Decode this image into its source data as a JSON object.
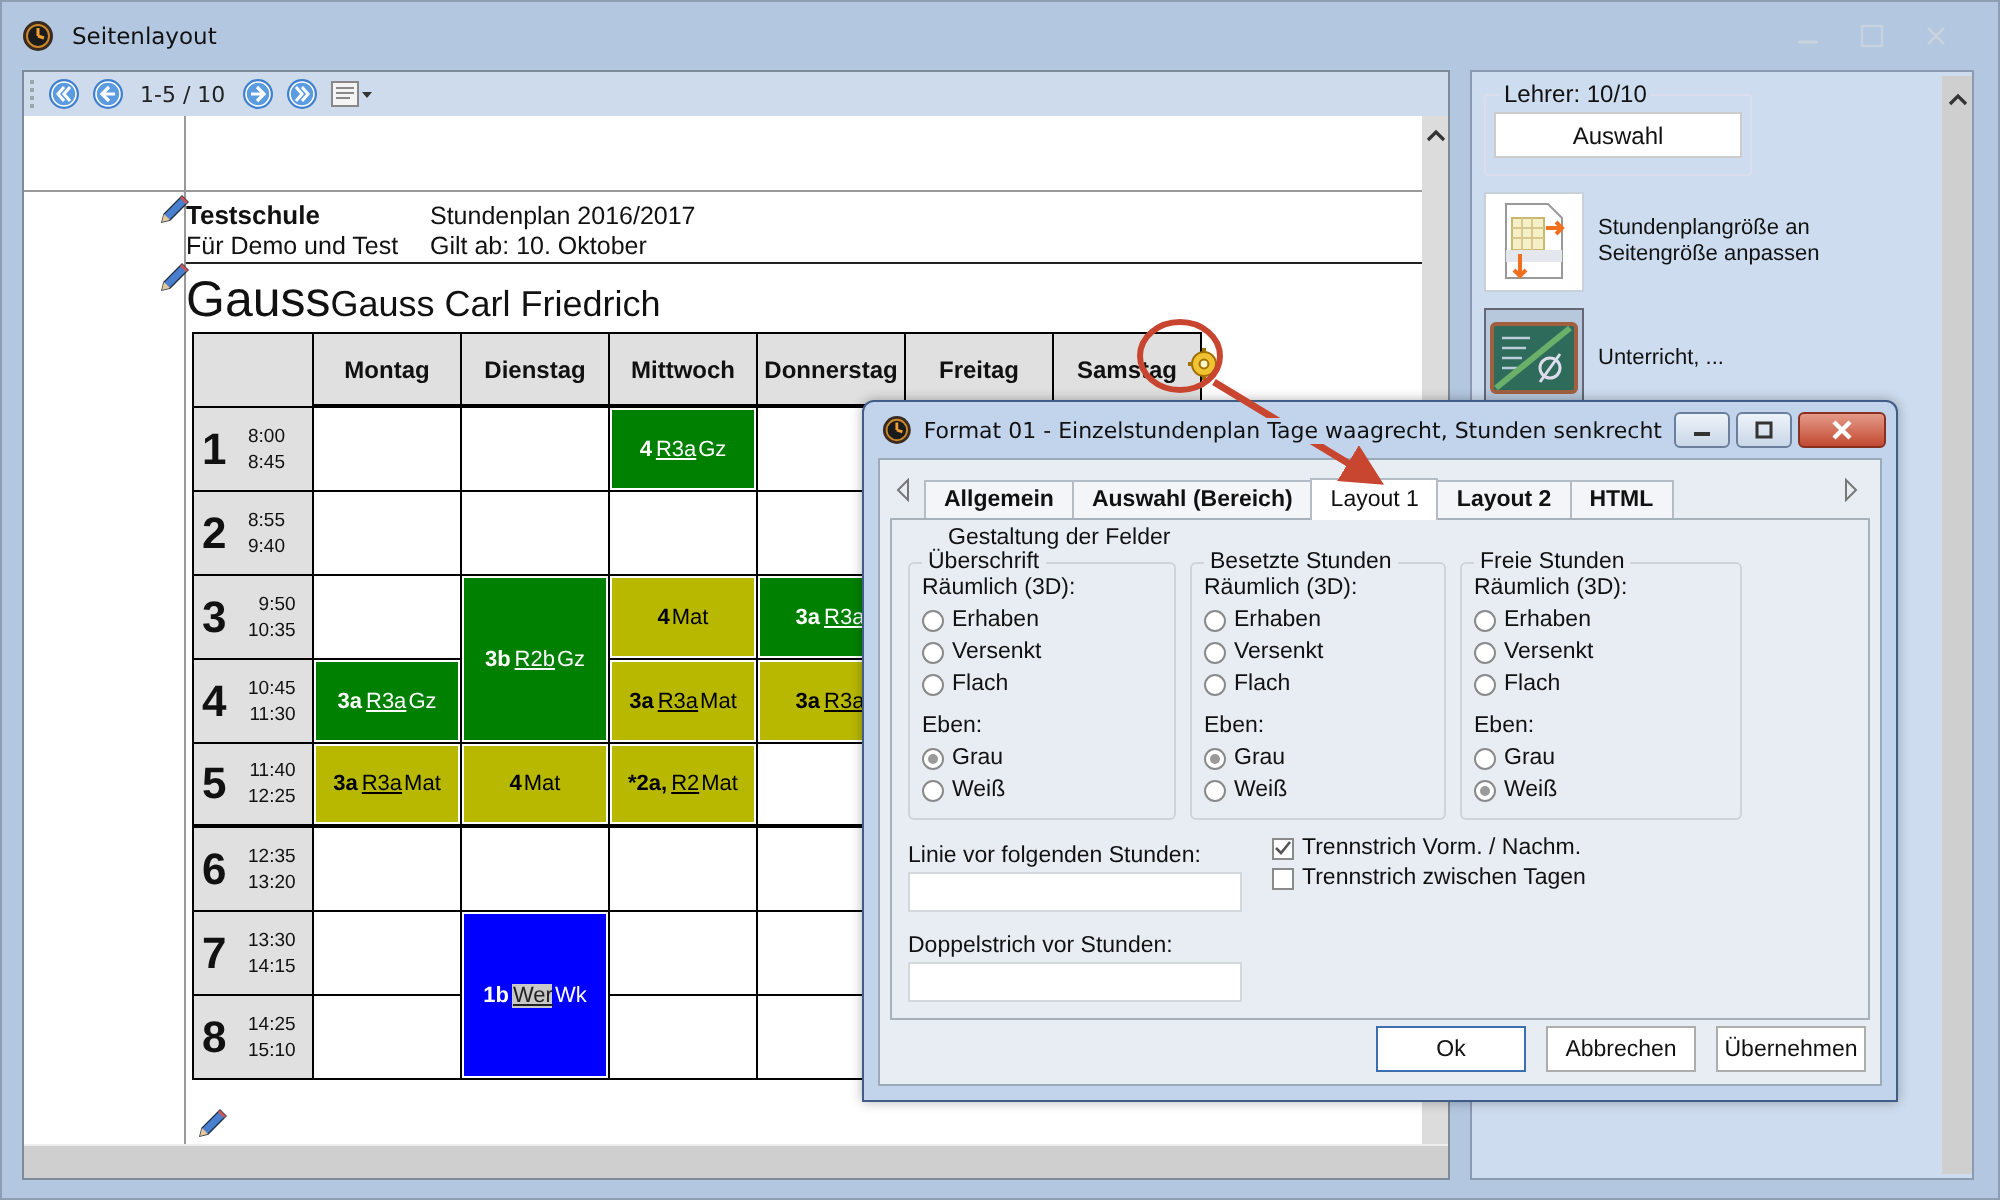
{
  "window": {
    "title": "Seitenlayout"
  },
  "toolbar": {
    "page_range": "1-5 / 10"
  },
  "page": {
    "school": "Testschule",
    "subtitle": "Für Demo und Test",
    "plan": "Stundenplan 2016/2017",
    "valid_from": "Gilt ab: 10. Oktober",
    "short_name": "Gauss",
    "full_name": "Gauss Carl Friedrich",
    "timetable": {
      "days": [
        "Montag",
        "Dienstag",
        "Mittwoch",
        "Donnerstag",
        "Freitag",
        "Samstag"
      ],
      "rows": [
        {
          "number": "1",
          "start": "8:00",
          "end": "8:45",
          "cells": [
            {
              "kind": "empty"
            },
            {
              "kind": "empty"
            },
            {
              "kind": "single",
              "class": "4",
              "room": "R3a",
              "subject": "Gz",
              "color": "#008000",
              "room_highlighted": false
            },
            {
              "kind": "empty"
            },
            {
              "kind": "empty"
            },
            {
              "kind": "empty"
            }
          ]
        },
        {
          "number": "2",
          "start": "8:55",
          "end": "9:40",
          "cells": [
            {
              "kind": "empty"
            },
            {
              "kind": "empty"
            },
            {
              "kind": "empty"
            },
            {
              "kind": "empty"
            },
            {
              "kind": "empty"
            },
            {
              "kind": "empty"
            }
          ]
        },
        {
          "number": "3",
          "start": "9:50",
          "end": "10:35",
          "cells": [
            {
              "kind": "empty"
            },
            {
              "kind": "double",
              "class": "3b",
              "room": "R2b",
              "subject": "Gz",
              "color": "#008000",
              "room_highlighted": false
            },
            {
              "kind": "single",
              "class": "4",
              "subject": "Mat",
              "color": "#b8b800"
            },
            {
              "kind": "single",
              "class": "3a",
              "room": "R3a",
              "color": "#008000",
              "room_highlighted": false
            },
            {
              "kind": "empty"
            },
            {
              "kind": "empty"
            }
          ]
        },
        {
          "number": "4",
          "start": "10:45",
          "end": "11:30",
          "cells": [
            {
              "kind": "single",
              "class": "3a",
              "room": "R3a",
              "subject": "Gz",
              "color": "#008000",
              "room_highlighted": false
            },
            {
              "kind": "covered"
            },
            {
              "kind": "single",
              "class": "3a",
              "room": "R3a",
              "subject": "Mat",
              "color": "#b8b800",
              "room_highlighted": false
            },
            {
              "kind": "single",
              "class": "3a",
              "room": "R3a",
              "color": "#b8b800",
              "room_highlighted": false
            },
            {
              "kind": "empty"
            },
            {
              "kind": "empty"
            }
          ]
        },
        {
          "number": "5",
          "start": "11:40",
          "end": "12:25",
          "cells": [
            {
              "kind": "single",
              "class": "3a",
              "room": "R3a",
              "subject": "Mat",
              "color": "#b8b800",
              "room_highlighted": false
            },
            {
              "kind": "single",
              "class": "4",
              "subject": "Mat",
              "color": "#b8b800"
            },
            {
              "kind": "single",
              "class": "*2a,",
              "room": "R2",
              "subject": "Mat",
              "color": "#b8b800",
              "room_highlighted": false
            },
            {
              "kind": "empty"
            },
            {
              "kind": "empty"
            },
            {
              "kind": "empty"
            }
          ]
        },
        {
          "number": "6",
          "start": "12:35",
          "end": "13:20",
          "cells": [
            {
              "kind": "empty"
            },
            {
              "kind": "empty"
            },
            {
              "kind": "empty"
            },
            {
              "kind": "empty"
            },
            {
              "kind": "empty"
            },
            {
              "kind": "empty"
            }
          ]
        },
        {
          "number": "7",
          "start": "13:30",
          "end": "14:15",
          "cells": [
            {
              "kind": "empty"
            },
            {
              "kind": "double",
              "class": "1b",
              "room": "Wer",
              "subject": "Wk",
              "color": "#0000ff",
              "room_highlighted": true
            },
            {
              "kind": "empty"
            },
            {
              "kind": "empty"
            },
            {
              "kind": "empty"
            },
            {
              "kind": "empty"
            }
          ]
        },
        {
          "number": "8",
          "start": "14:25",
          "end": "15:10",
          "cells": [
            {
              "kind": "empty"
            },
            {
              "kind": "covered"
            },
            {
              "kind": "empty"
            },
            {
              "kind": "empty"
            },
            {
              "kind": "empty"
            },
            {
              "kind": "empty"
            }
          ]
        }
      ]
    }
  },
  "side_panel": {
    "group_label": "Lehrer: 10/10",
    "select_button": "Auswahl",
    "actions": [
      {
        "kind": "fit",
        "label": "Stundenplangröße an Seitengröße anpassen"
      },
      {
        "kind": "lessons",
        "label": "Unterricht, ..."
      }
    ]
  },
  "dialog": {
    "title": "Format 01 - Einzelstundenplan Tage waagrecht, Stunden senkrecht",
    "tabs": [
      {
        "label": "Allgemein",
        "selected": false
      },
      {
        "label": "Auswahl (Bereich)",
        "selected": false
      },
      {
        "label": "Layout 1",
        "selected": true
      },
      {
        "label": "Layout 2",
        "selected": false
      },
      {
        "label": "HTML",
        "selected": false
      }
    ],
    "section_label": "Gestaltung der Felder",
    "groups": [
      {
        "title": "Überschrift",
        "relief_label": "Räumlich (3D):",
        "relief_options": [
          {
            "label": "Erhaben",
            "selected": false
          },
          {
            "label": "Versenkt",
            "selected": false
          },
          {
            "label": "Flach",
            "selected": false
          }
        ],
        "flat_label": "Eben:",
        "flat_options": [
          {
            "label": "Grau",
            "selected": true
          },
          {
            "label": "Weiß",
            "selected": false
          }
        ]
      },
      {
        "title": "Besetzte Stunden",
        "relief_label": "Räumlich (3D):",
        "relief_options": [
          {
            "label": "Erhaben",
            "selected": false
          },
          {
            "label": "Versenkt",
            "selected": false
          },
          {
            "label": "Flach",
            "selected": false
          }
        ],
        "flat_label": "Eben:",
        "flat_options": [
          {
            "label": "Grau",
            "selected": true
          },
          {
            "label": "Weiß",
            "selected": false
          }
        ]
      },
      {
        "title": "Freie Stunden",
        "relief_label": "Räumlich (3D):",
        "relief_options": [
          {
            "label": "Erhaben",
            "selected": false
          },
          {
            "label": "Versenkt",
            "selected": false
          },
          {
            "label": "Flach",
            "selected": false
          }
        ],
        "flat_label": "Eben:",
        "flat_options": [
          {
            "label": "Grau",
            "selected": false
          },
          {
            "label": "Weiß",
            "selected": true
          }
        ]
      }
    ],
    "fields": [
      {
        "label": "Linie vor folgenden Stunden:"
      },
      {
        "label": "Doppelstrich vor Stunden:"
      }
    ],
    "checkboxes": [
      {
        "label": "Trennstrich Vorm. / Nachm.",
        "checked": true
      },
      {
        "label": "Trennstrich zwischen Tagen",
        "checked": false
      }
    ],
    "buttons": [
      {
        "label": "Ok",
        "kind": "default"
      },
      {
        "label": "Abbrechen",
        "kind": "normal"
      },
      {
        "label": "Übernehmen",
        "kind": "normal"
      }
    ]
  }
}
